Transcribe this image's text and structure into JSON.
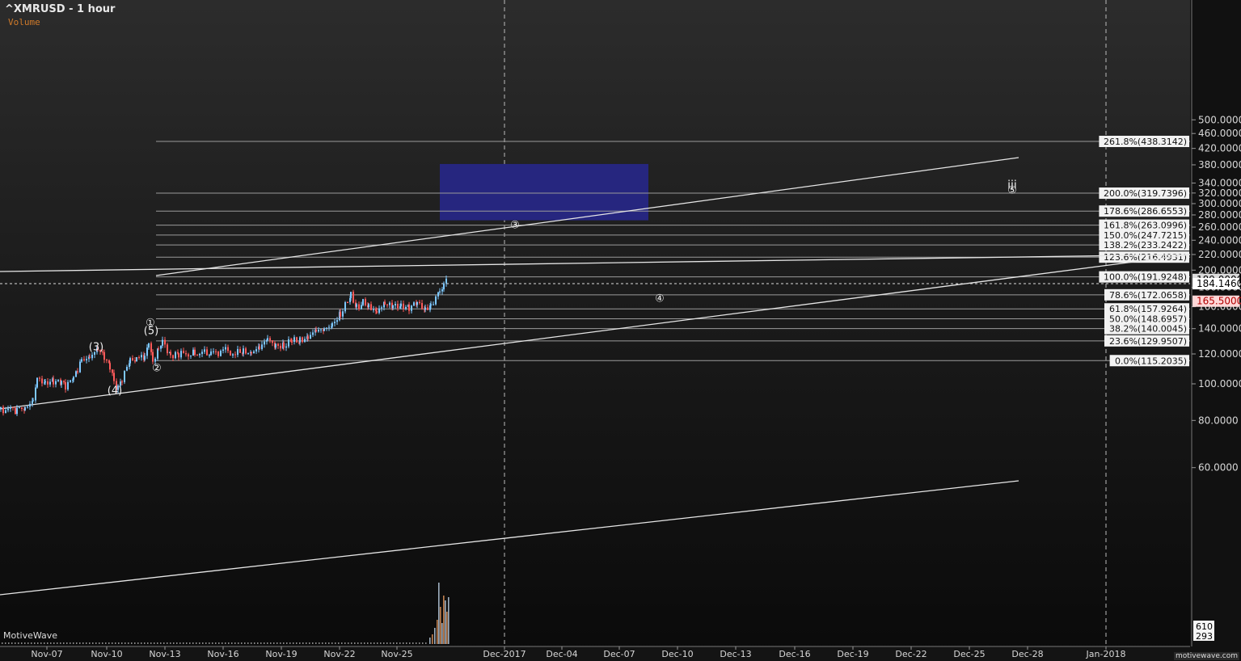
{
  "header": {
    "title": "^XMRUSD - 1 hour",
    "indicator": "Volume"
  },
  "brand": "MotiveWave",
  "watermark": "motivewave.com",
  "colors": {
    "zone": "#26267f",
    "up": "#7ec8ff",
    "down": "#ff5a5a",
    "line": "#e6e6e6",
    "volume": "#c08050"
  },
  "chart_data": {
    "type": "candlestick",
    "scale": "log",
    "ylim": [
      54,
      515
    ],
    "y_ticks": [
      "500.0000",
      "460.0000",
      "420.0000",
      "380.0000",
      "340.0000",
      "320.0000",
      "300.0000",
      "280.0000",
      "260.0000",
      "240.0000",
      "220.0000",
      "200.0000",
      "180.0000",
      "160.0000",
      "140.0000",
      "120.0000",
      "100.0000",
      "80.0000",
      "60.0000"
    ],
    "x_labels": [
      "Nov-07",
      "Nov-10",
      "Nov-13",
      "Nov-16",
      "Nov-19",
      "Nov-22",
      "Nov-25",
      "Dec-2017",
      "Dec-04",
      "Dec-07",
      "Dec-10",
      "Dec-13",
      "Dec-16",
      "Dec-19",
      "Dec-22",
      "Dec-25",
      "Dec-28",
      "Jan-2018"
    ],
    "fib_levels": [
      {
        "label": "261.8%(438.3142)",
        "value": 438.3142
      },
      {
        "label": "200.0%(319.7396)",
        "value": 319.7396
      },
      {
        "label": "178.6%(286.6553)",
        "value": 286.6553
      },
      {
        "label": "161.8%(263.0996)",
        "value": 263.0996
      },
      {
        "label": "150.0%(247.7215)",
        "value": 247.7215
      },
      {
        "label": "138.2%(233.2422)",
        "value": 233.2422
      },
      {
        "label": "123.6%(216.4931)",
        "value": 216.4931
      },
      {
        "label": "100.0%(191.9248)",
        "value": 191.9248
      },
      {
        "label": "78.6%(172.0658)",
        "value": 172.0658
      },
      {
        "label": "61.8%(157.9264)",
        "value": 157.9264
      },
      {
        "label": "50.0%(148.6957)",
        "value": 148.6957
      },
      {
        "label": "38.2%(140.0045)",
        "value": 140.0045
      },
      {
        "label": "23.6%(129.9507)",
        "value": 129.9507
      },
      {
        "label": "0.0%(115.2035)",
        "value": 115.2035
      }
    ],
    "price_tags": [
      {
        "label": "189.0000",
        "value": 189.0,
        "style": "light"
      },
      {
        "label": "184.1460",
        "value": 184.146,
        "style": "white"
      },
      {
        "label": "165.5000",
        "value": 165.5,
        "style": "red"
      }
    ],
    "current_price": 184.146,
    "volume_tags": [
      "610",
      "293"
    ],
    "target_zone": {
      "from": "Nov-28",
      "to": "Dec-09",
      "low": 271,
      "high": 382
    },
    "wave_labels": [
      {
        "text": "(3)",
        "value": 125,
        "x": "Nov-09"
      },
      {
        "text": "(4)",
        "value": 96,
        "x": "Nov-10"
      },
      {
        "text": "(5)",
        "value": 138,
        "x": "Nov-12"
      },
      {
        "text": "①",
        "value": 145,
        "x": "Nov-12"
      },
      {
        "text": "②",
        "value": 110,
        "x": "Nov-12"
      },
      {
        "text": "③",
        "value": 263,
        "x": "Dec-01"
      },
      {
        "text": "④",
        "value": 168,
        "x": "Dec-08"
      },
      {
        "text": "iii",
        "value": 335,
        "x": "Dec-27"
      },
      {
        "text": "⑤",
        "value": 325,
        "x": "Dec-27"
      }
    ],
    "price_path": [
      [
        0,
        86
      ],
      [
        20,
        85
      ],
      [
        30,
        86
      ],
      [
        40,
        92
      ],
      [
        45,
        103
      ],
      [
        55,
        102
      ],
      [
        65,
        101
      ],
      [
        75,
        100
      ],
      [
        80,
        99
      ],
      [
        90,
        102
      ],
      [
        95,
        110
      ],
      [
        100,
        116
      ],
      [
        110,
        119
      ],
      [
        120,
        122
      ],
      [
        128,
        118
      ],
      [
        135,
        110
      ],
      [
        140,
        102
      ],
      [
        145,
        97
      ],
      [
        150,
        103
      ],
      [
        160,
        114
      ],
      [
        168,
        116
      ],
      [
        178,
        118
      ],
      [
        183,
        128
      ],
      [
        188,
        115
      ],
      [
        195,
        125
      ],
      [
        200,
        130
      ],
      [
        210,
        120
      ],
      [
        220,
        119
      ],
      [
        240,
        121
      ],
      [
        260,
        120
      ],
      [
        275,
        123
      ],
      [
        290,
        120
      ],
      [
        300,
        121
      ],
      [
        310,
        123
      ],
      [
        320,
        124
      ],
      [
        330,
        130
      ],
      [
        340,
        128
      ],
      [
        350,
        126
      ],
      [
        360,
        129
      ],
      [
        370,
        130
      ],
      [
        380,
        135
      ],
      [
        390,
        137
      ],
      [
        400,
        138
      ],
      [
        410,
        146
      ],
      [
        420,
        152
      ],
      [
        426,
        160
      ],
      [
        433,
        171
      ],
      [
        440,
        160
      ],
      [
        448,
        164
      ],
      [
        455,
        160
      ],
      [
        465,
        158
      ],
      [
        475,
        161
      ],
      [
        485,
        160
      ],
      [
        495,
        163
      ],
      [
        505,
        159
      ],
      [
        515,
        162
      ],
      [
        525,
        158
      ],
      [
        532,
        163
      ],
      [
        538,
        170
      ],
      [
        543,
        177
      ],
      [
        548,
        183
      ],
      [
        553,
        189
      ]
    ]
  }
}
